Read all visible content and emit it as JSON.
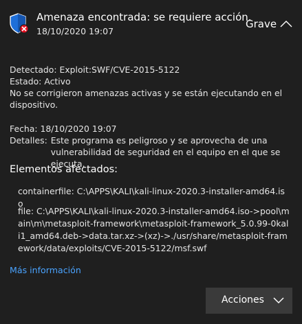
{
  "header": {
    "title": "Amenaza encontrada: se requiere acción.",
    "datetime": "18/10/2020 19:07",
    "severity": "Grave",
    "shield_icon": "shield-warning-icon",
    "collapse_icon": "chevron-up-icon"
  },
  "details": {
    "detected_label": "Detectado:",
    "detected_value": "Exploit:SWF/CVE-2015-5122",
    "status_label": "Estado:",
    "status_value": "Activo",
    "status_note": "No se corrigieron amenazas activas y se están ejecutando en el dispositivo.",
    "date_label": "Fecha:",
    "date_value": "18/10/2020 19:07",
    "details_label": "Detalles:",
    "details_value": "Este programa es peligroso y se aprovecha de una vulnerabilidad de seguridad en el equipo en el que se ejecuta."
  },
  "affected": {
    "title": "Elementos afectados:",
    "items": [
      "containerfile: C:\\APPS\\KALI\\kali-linux-2020.3-installer-amd64.iso",
      "file: C:\\APPS\\KALI\\kali-linux-2020.3-installer-amd64.iso->pool\\main\\m\\metasploit-framework\\metasploit-framework_5.0.99-0kali1_amd64.deb->data.tar.xz->(xz)->./usr/share/metasploit-framework/data/exploits/CVE-2015-5122/msf.swf"
    ]
  },
  "more_info": "Más información",
  "actions_button": "Acciones",
  "colors": {
    "background": "#1f1f1f",
    "accent_link": "#4aa3ff",
    "shield_blue": "#1e6fd9",
    "alert_red": "#e81123",
    "button_bg": "#3a3a3a"
  }
}
